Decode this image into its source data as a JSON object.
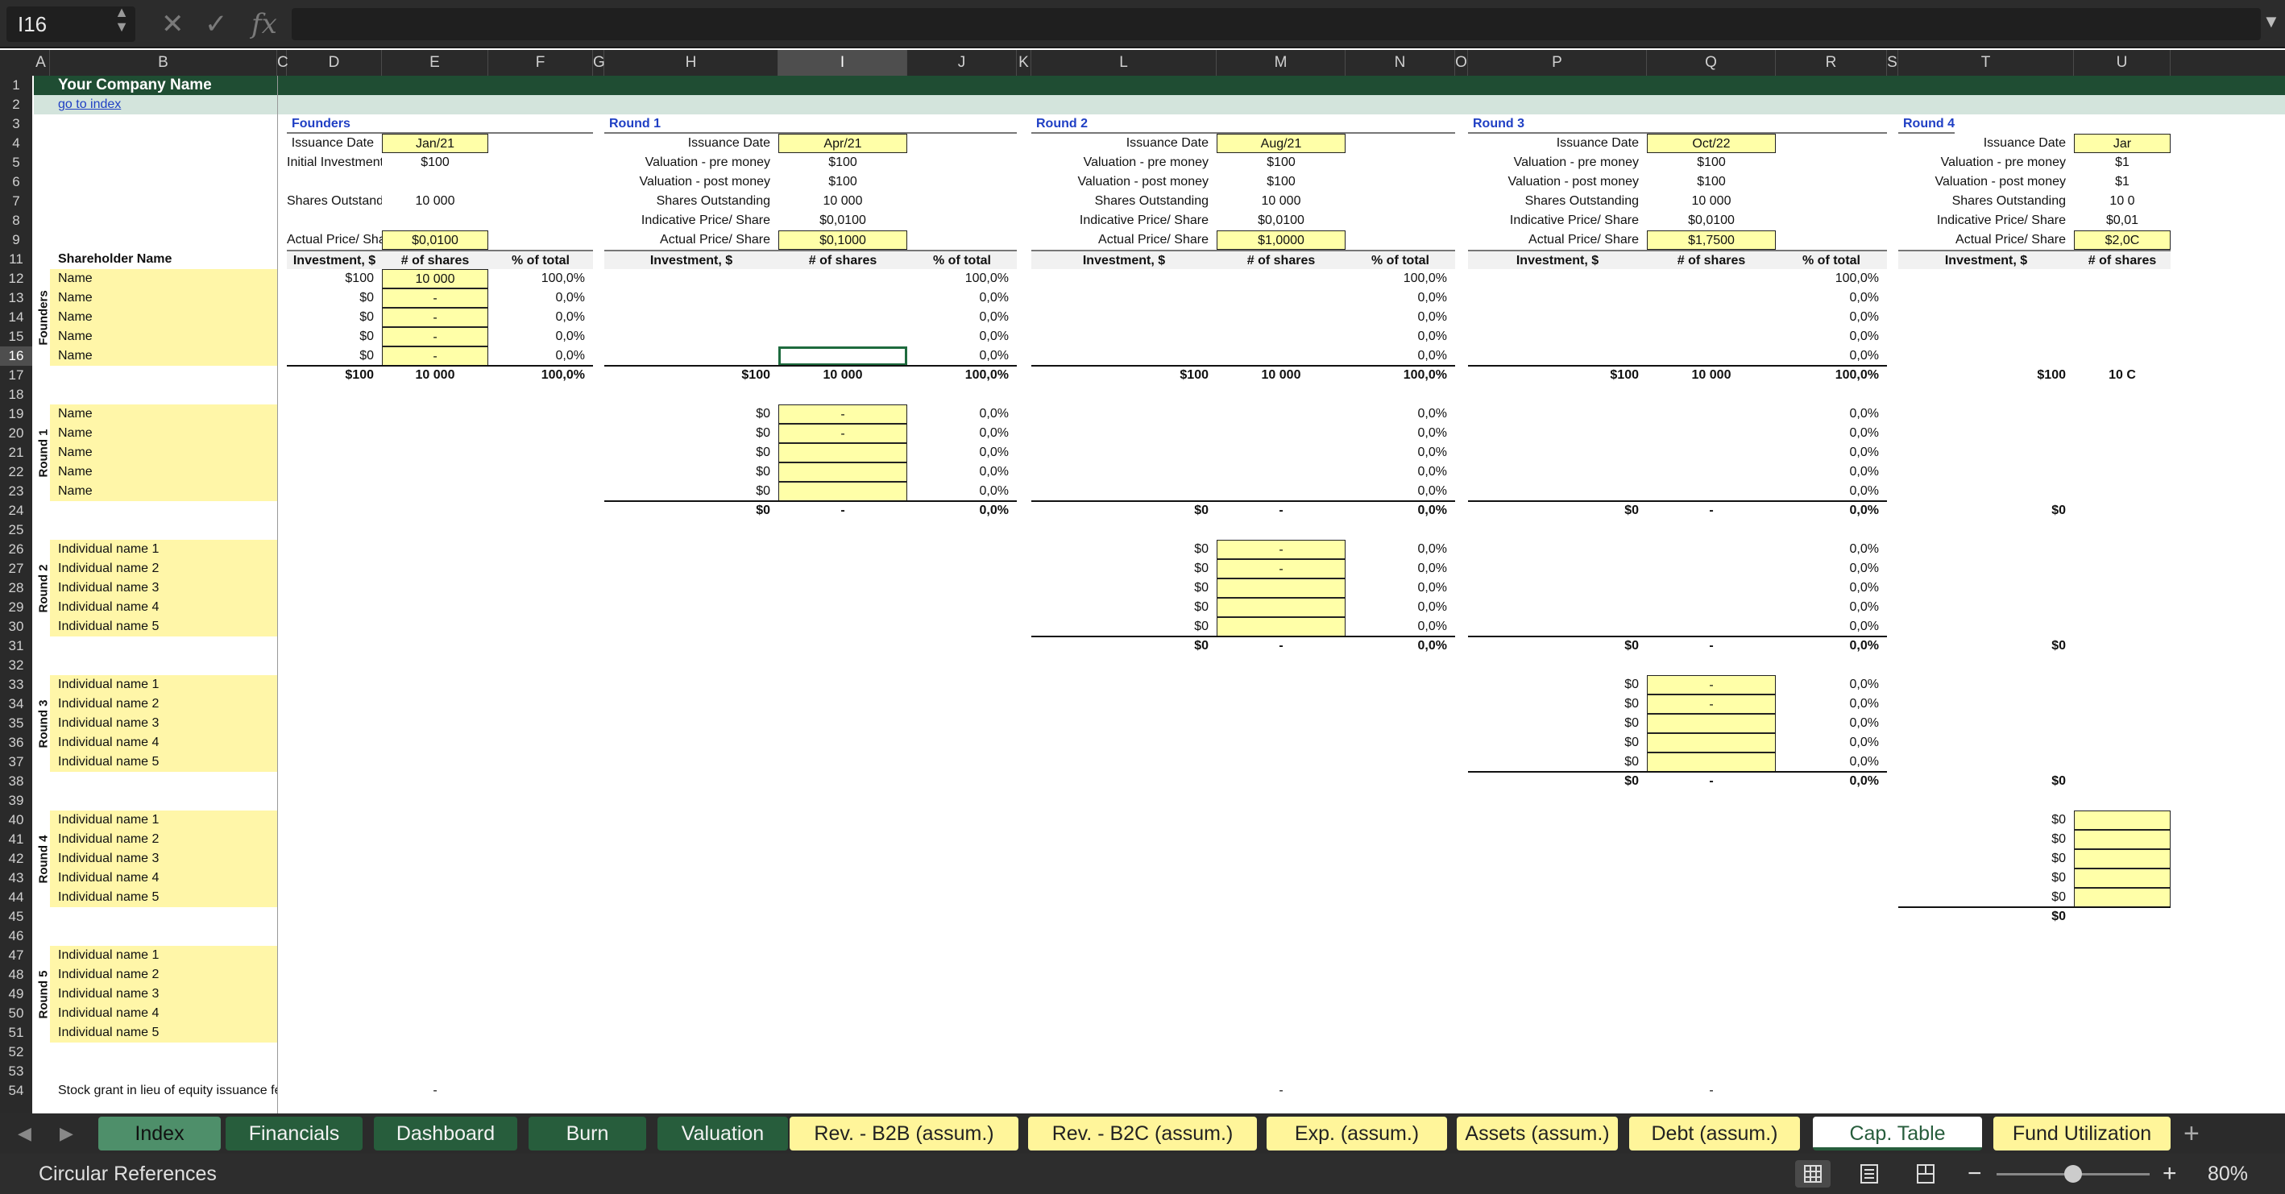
{
  "cell_ref": "I16",
  "status_text": "Circular References",
  "zoom": "80%",
  "zoom_level_fraction": 0.5,
  "columns": [
    "A",
    "B",
    "C",
    "D",
    "E",
    "F",
    "G",
    "H",
    "I",
    "J",
    "K",
    "L",
    "M",
    "N",
    "O",
    "P",
    "Q",
    "R",
    "S",
    "T",
    "U"
  ],
  "rows": [
    "1",
    "2",
    "3",
    "4",
    "5",
    "6",
    "7",
    "8",
    "9",
    "11",
    "12",
    "13",
    "14",
    "15",
    "16",
    "17",
    "18",
    "19",
    "20",
    "21",
    "22",
    "23",
    "24",
    "25",
    "26",
    "27",
    "28",
    "29",
    "30",
    "31",
    "32",
    "33",
    "34",
    "35",
    "36",
    "37",
    "38",
    "39",
    "40",
    "41",
    "42",
    "43",
    "44",
    "45",
    "46",
    "47",
    "48",
    "49",
    "50",
    "51",
    "52",
    "53",
    "54"
  ],
  "company": "Your Company Name",
  "index_link": "go to index",
  "shareholder_header": "Shareholder Name",
  "col_headers": [
    "Investment, $",
    "# of shares",
    "% of total"
  ],
  "round_labels": [
    "Founders",
    "Round 1",
    "Round 2",
    "Round 3",
    "Round 4",
    "Round 5"
  ],
  "name": "Name",
  "individual_names": [
    "Individual name 1",
    "Individual name 2",
    "Individual name 3",
    "Individual name 4",
    "Individual name 5"
  ],
  "stock_grant": "Stock grant in lieu of equity issuance fee",
  "dash": "-",
  "blocks": [
    {
      "title": "Founders",
      "labels": [
        "Issuance Date",
        "Initial Investment",
        "",
        "Shares Outstanding",
        "",
        "Actual Price/ Share"
      ],
      "values": [
        "Jan/21",
        "$100",
        "",
        "10 000",
        "",
        "$0,0100"
      ],
      "yellow": [
        true,
        false,
        false,
        false,
        false,
        true
      ]
    },
    {
      "title": "Round 1",
      "labels": [
        "Issuance Date",
        "Valuation - pre money",
        "Valuation - post money",
        "Shares Outstanding",
        "Indicative Price/ Share",
        "Actual Price/ Share"
      ],
      "values": [
        "Apr/21",
        "$100",
        "$100",
        "10 000",
        "$0,0100",
        "$0,1000"
      ],
      "yellow": [
        true,
        false,
        false,
        false,
        false,
        true
      ]
    },
    {
      "title": "Round 2",
      "labels": [
        "Issuance Date",
        "Valuation - pre money",
        "Valuation - post money",
        "Shares Outstanding",
        "Indicative Price/ Share",
        "Actual Price/ Share"
      ],
      "values": [
        "Aug/21",
        "$100",
        "$100",
        "10 000",
        "$0,0100",
        "$1,0000"
      ],
      "yellow": [
        true,
        false,
        false,
        false,
        false,
        true
      ]
    },
    {
      "title": "Round 3",
      "labels": [
        "Issuance Date",
        "Valuation - pre money",
        "Valuation - post money",
        "Shares Outstanding",
        "Indicative Price/ Share",
        "Actual Price/ Share"
      ],
      "values": [
        "Oct/22",
        "$100",
        "$100",
        "10 000",
        "$0,0100",
        "$1,7500"
      ],
      "yellow": [
        true,
        false,
        false,
        false,
        false,
        true
      ]
    },
    {
      "title": "Round 4",
      "labels": [
        "Issuance Date",
        "Valuation - pre money",
        "Valuation - post money",
        "Shares Outstanding",
        "Indicative Price/ Share",
        "Actual Price/ Share"
      ],
      "values": [
        "Jar",
        "$1",
        "$1",
        "10 0",
        "$0,01",
        "$2,0C"
      ],
      "yellow": [
        true,
        false,
        false,
        false,
        false,
        true
      ]
    }
  ],
  "founders_rows": {
    "inv": [
      "$100",
      "$0",
      "$0",
      "$0",
      "$0"
    ],
    "shares": [
      "10 000",
      "-",
      "-",
      "-",
      "-"
    ],
    "pct": [
      "100,0%",
      "0,0%",
      "0,0%",
      "0,0%",
      "0,0%"
    ]
  },
  "r1_pct": [
    "100,0%",
    "0,0%",
    "0,0%",
    "0,0%",
    "0,0%"
  ],
  "r2_pct": [
    "100,0%",
    "0,0%",
    "0,0%",
    "0,0%",
    "0,0%"
  ],
  "r3_pct": [
    "100,0%",
    "0,0%",
    "0,0%",
    "0,0%",
    "0,0%"
  ],
  "totals17": {
    "inv": "$100",
    "shares": "10 000",
    "pct": "100,0%",
    "r4_shares": "10 C"
  },
  "zero_inv": "$0",
  "zero_pct": "0,0%",
  "tabs": [
    "Index",
    "Financials",
    "Dashboard",
    "Burn",
    "Valuation",
    "Rev. - B2B (assum.)",
    "Rev. - B2C (assum.)",
    "Exp. (assum.)",
    "Assets (assum.)",
    "Debt (assum.)",
    "Cap. Table",
    "Fund Utilization"
  ],
  "colors": {
    "dark_header": "#1f4d33",
    "light_band": "#d3e4dc",
    "yellow": "#fff6a8",
    "tab_dark": "#275d3c",
    "tab_yellow": "#fff59a"
  }
}
